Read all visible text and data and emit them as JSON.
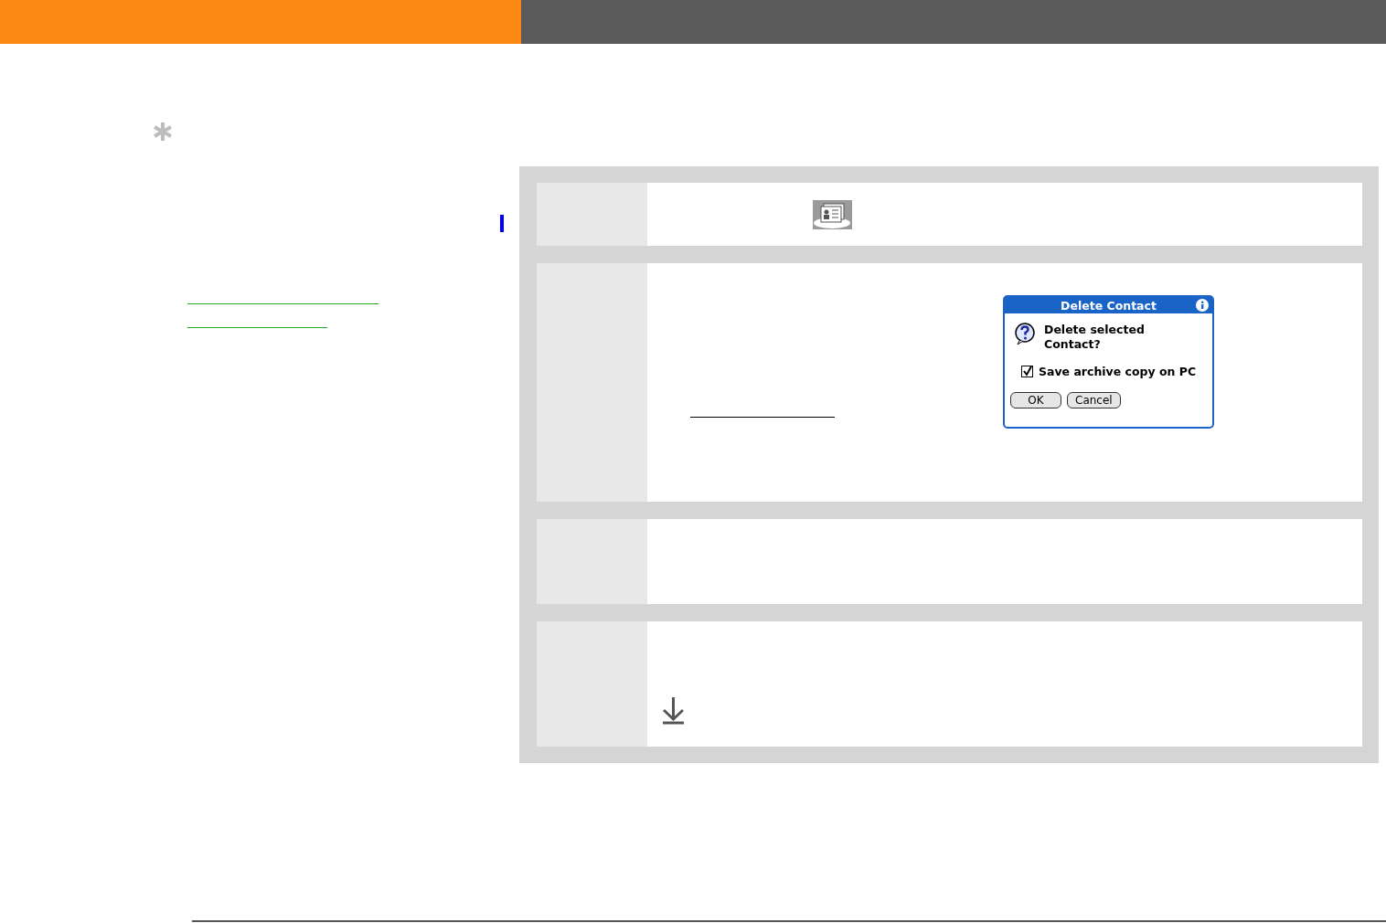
{
  "dialog": {
    "title": "Delete Contact",
    "message": "Delete selected Contact?",
    "checkbox": {
      "label": "Save archive copy on PC",
      "checked": true
    },
    "buttons": [
      "OK",
      "Cancel"
    ]
  }
}
